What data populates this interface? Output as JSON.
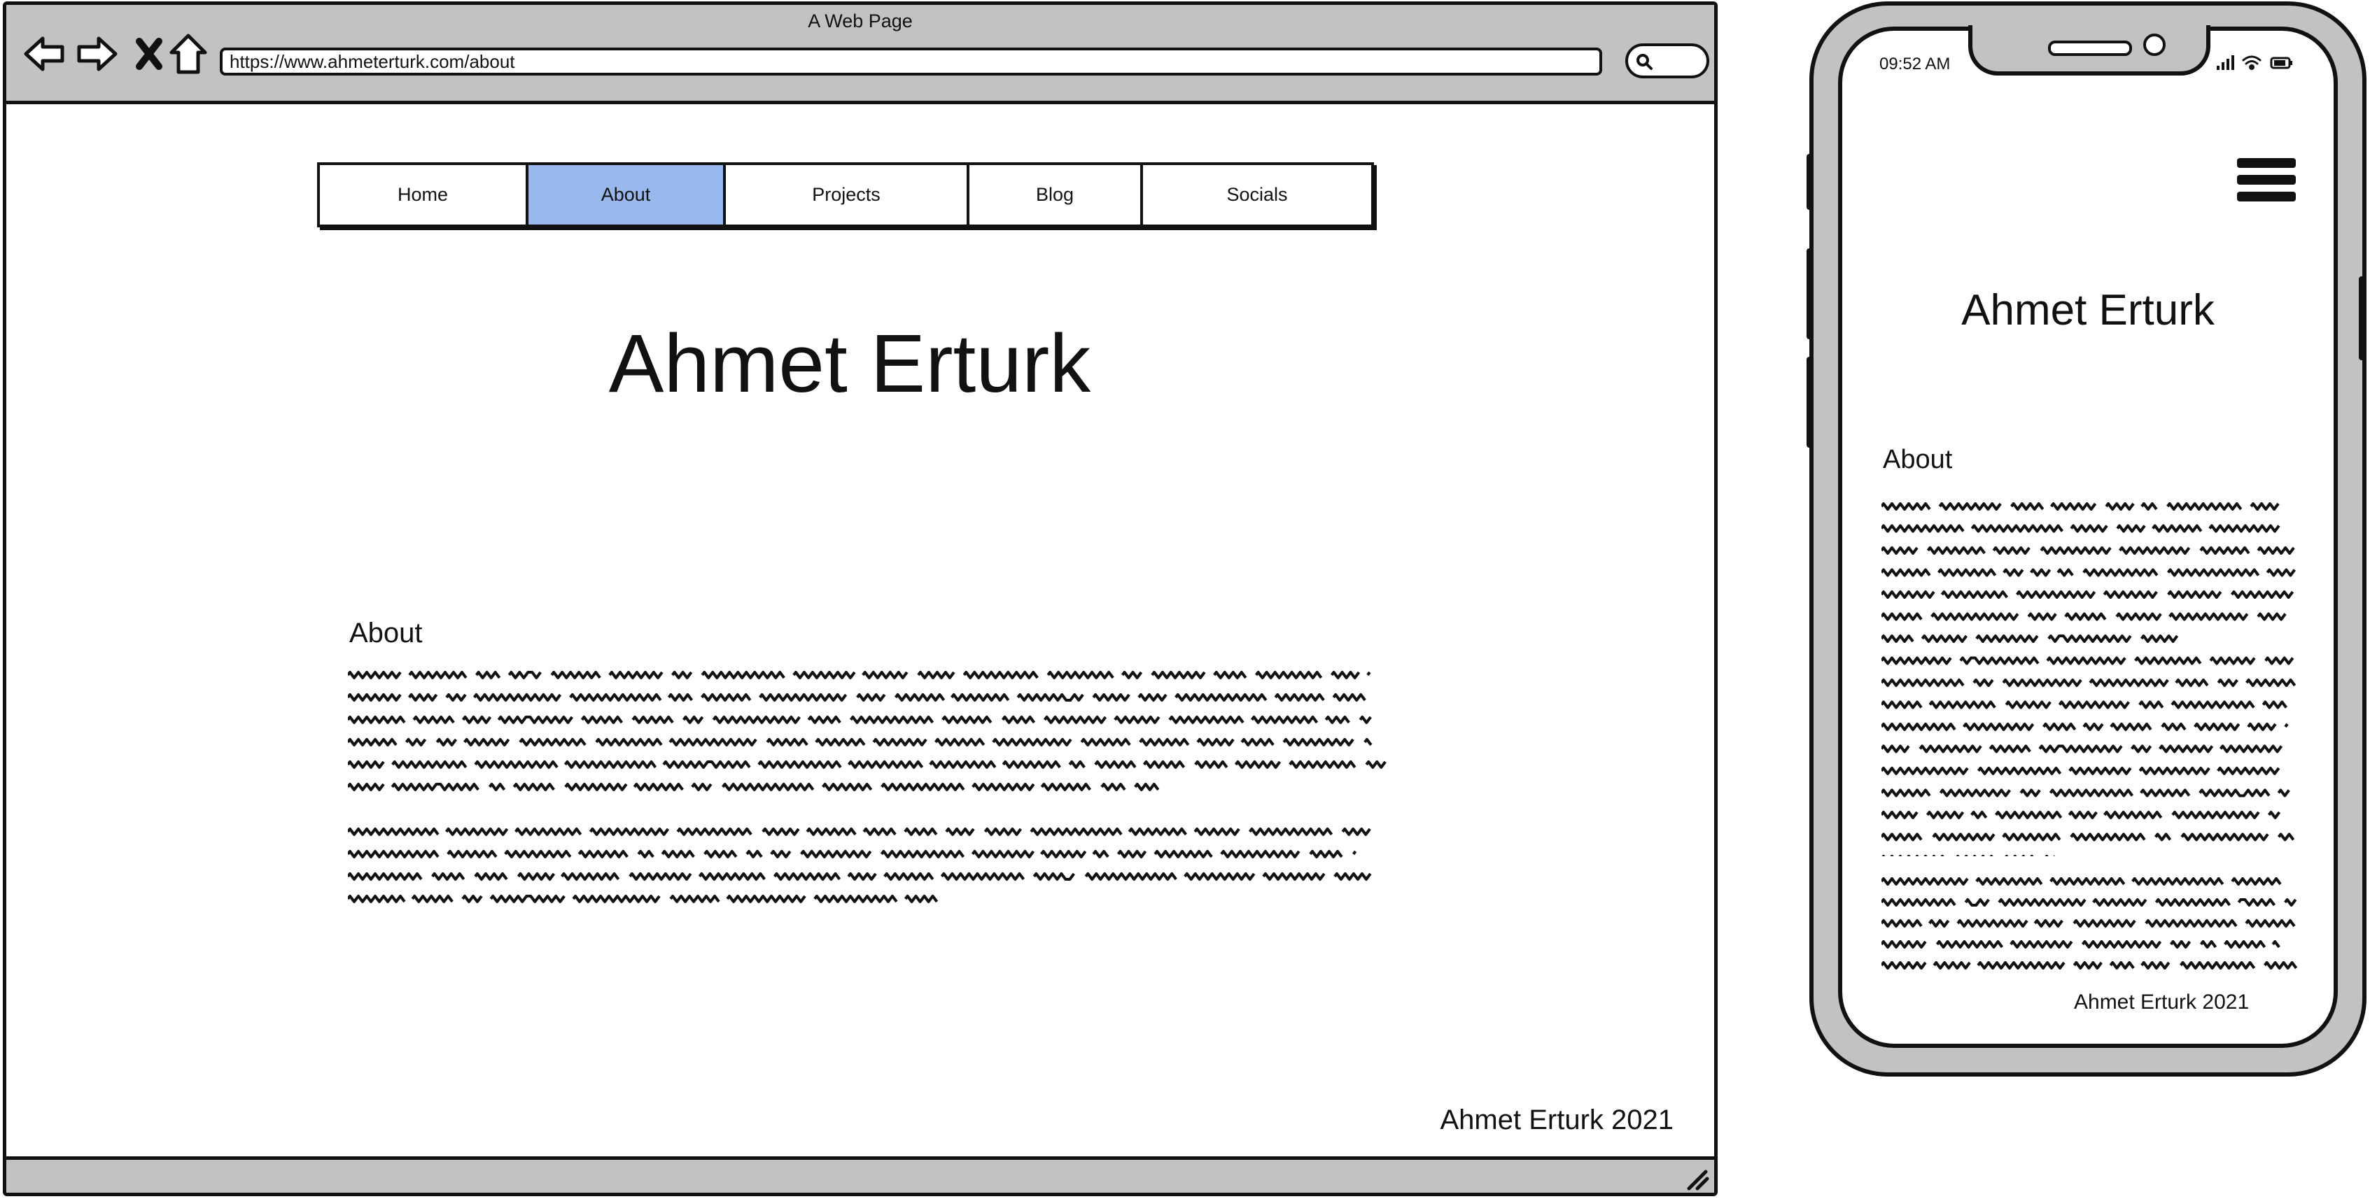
{
  "desktop": {
    "window_title": "A Web Page",
    "url": "https://www.ahmeterturk.com/about",
    "toolbar_icons": [
      "back-icon",
      "forward-icon",
      "stop-icon",
      "home-icon",
      "search-icon"
    ],
    "nav": [
      {
        "label": "Home",
        "active": false
      },
      {
        "label": "About",
        "active": true
      },
      {
        "label": "Projects",
        "active": false
      },
      {
        "label": "Blog",
        "active": false
      },
      {
        "label": "Socials",
        "active": false
      }
    ],
    "title": "Ahmet Erturk",
    "section_heading": "About",
    "footer": "Ahmet Erturk 2021"
  },
  "phone": {
    "time": "09:52 AM",
    "status_icons": [
      "signal-icon",
      "wifi-icon",
      "battery-icon"
    ],
    "menu_icon": "hamburger-menu-icon",
    "title": "Ahmet Erturk",
    "section_heading": "About",
    "footer": "Ahmet Erturk 2021"
  },
  "colors": {
    "chrome": "#c2c2c2",
    "active_tab": "#98b8ee",
    "ink": "#111111"
  }
}
